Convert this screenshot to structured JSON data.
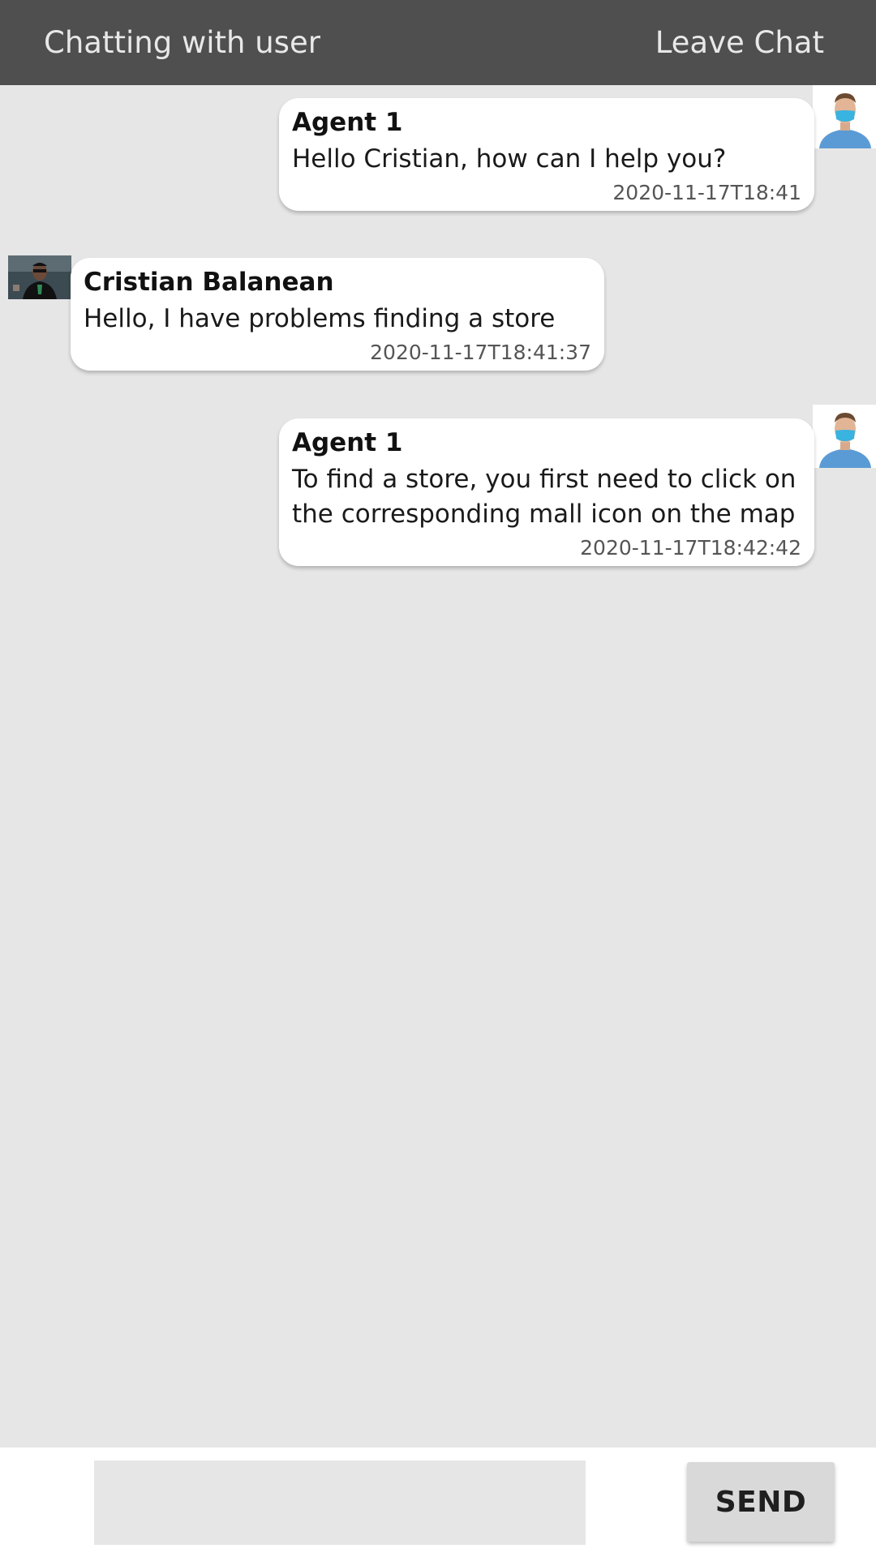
{
  "header": {
    "title": "Chatting with user",
    "leave_label": "Leave Chat"
  },
  "messages": [
    {
      "sender": "Agent 1",
      "side": "right",
      "text": "Hello Cristian, how can I help you?",
      "time": "2020-11-17T18:41"
    },
    {
      "sender": "Cristian Balanean",
      "side": "left",
      "text": "Hello, I have problems finding a store",
      "time": "2020-11-17T18:41:37"
    },
    {
      "sender": "Agent 1",
      "side": "right",
      "text": "To find a store, you first need to click on the corresponding mall icon on the map",
      "time": "2020-11-17T18:42:42"
    }
  ],
  "composer": {
    "input_value": "",
    "input_placeholder": "",
    "send_label": "SEND"
  },
  "colors": {
    "header_bg": "#4f4f4f",
    "chat_bg": "#e6e6e6",
    "bubble_bg": "#ffffff",
    "send_bg": "#d9d9d9"
  },
  "icons": {
    "agent_avatar": "agent-avatar-icon",
    "user_avatar": "user-avatar-icon"
  }
}
